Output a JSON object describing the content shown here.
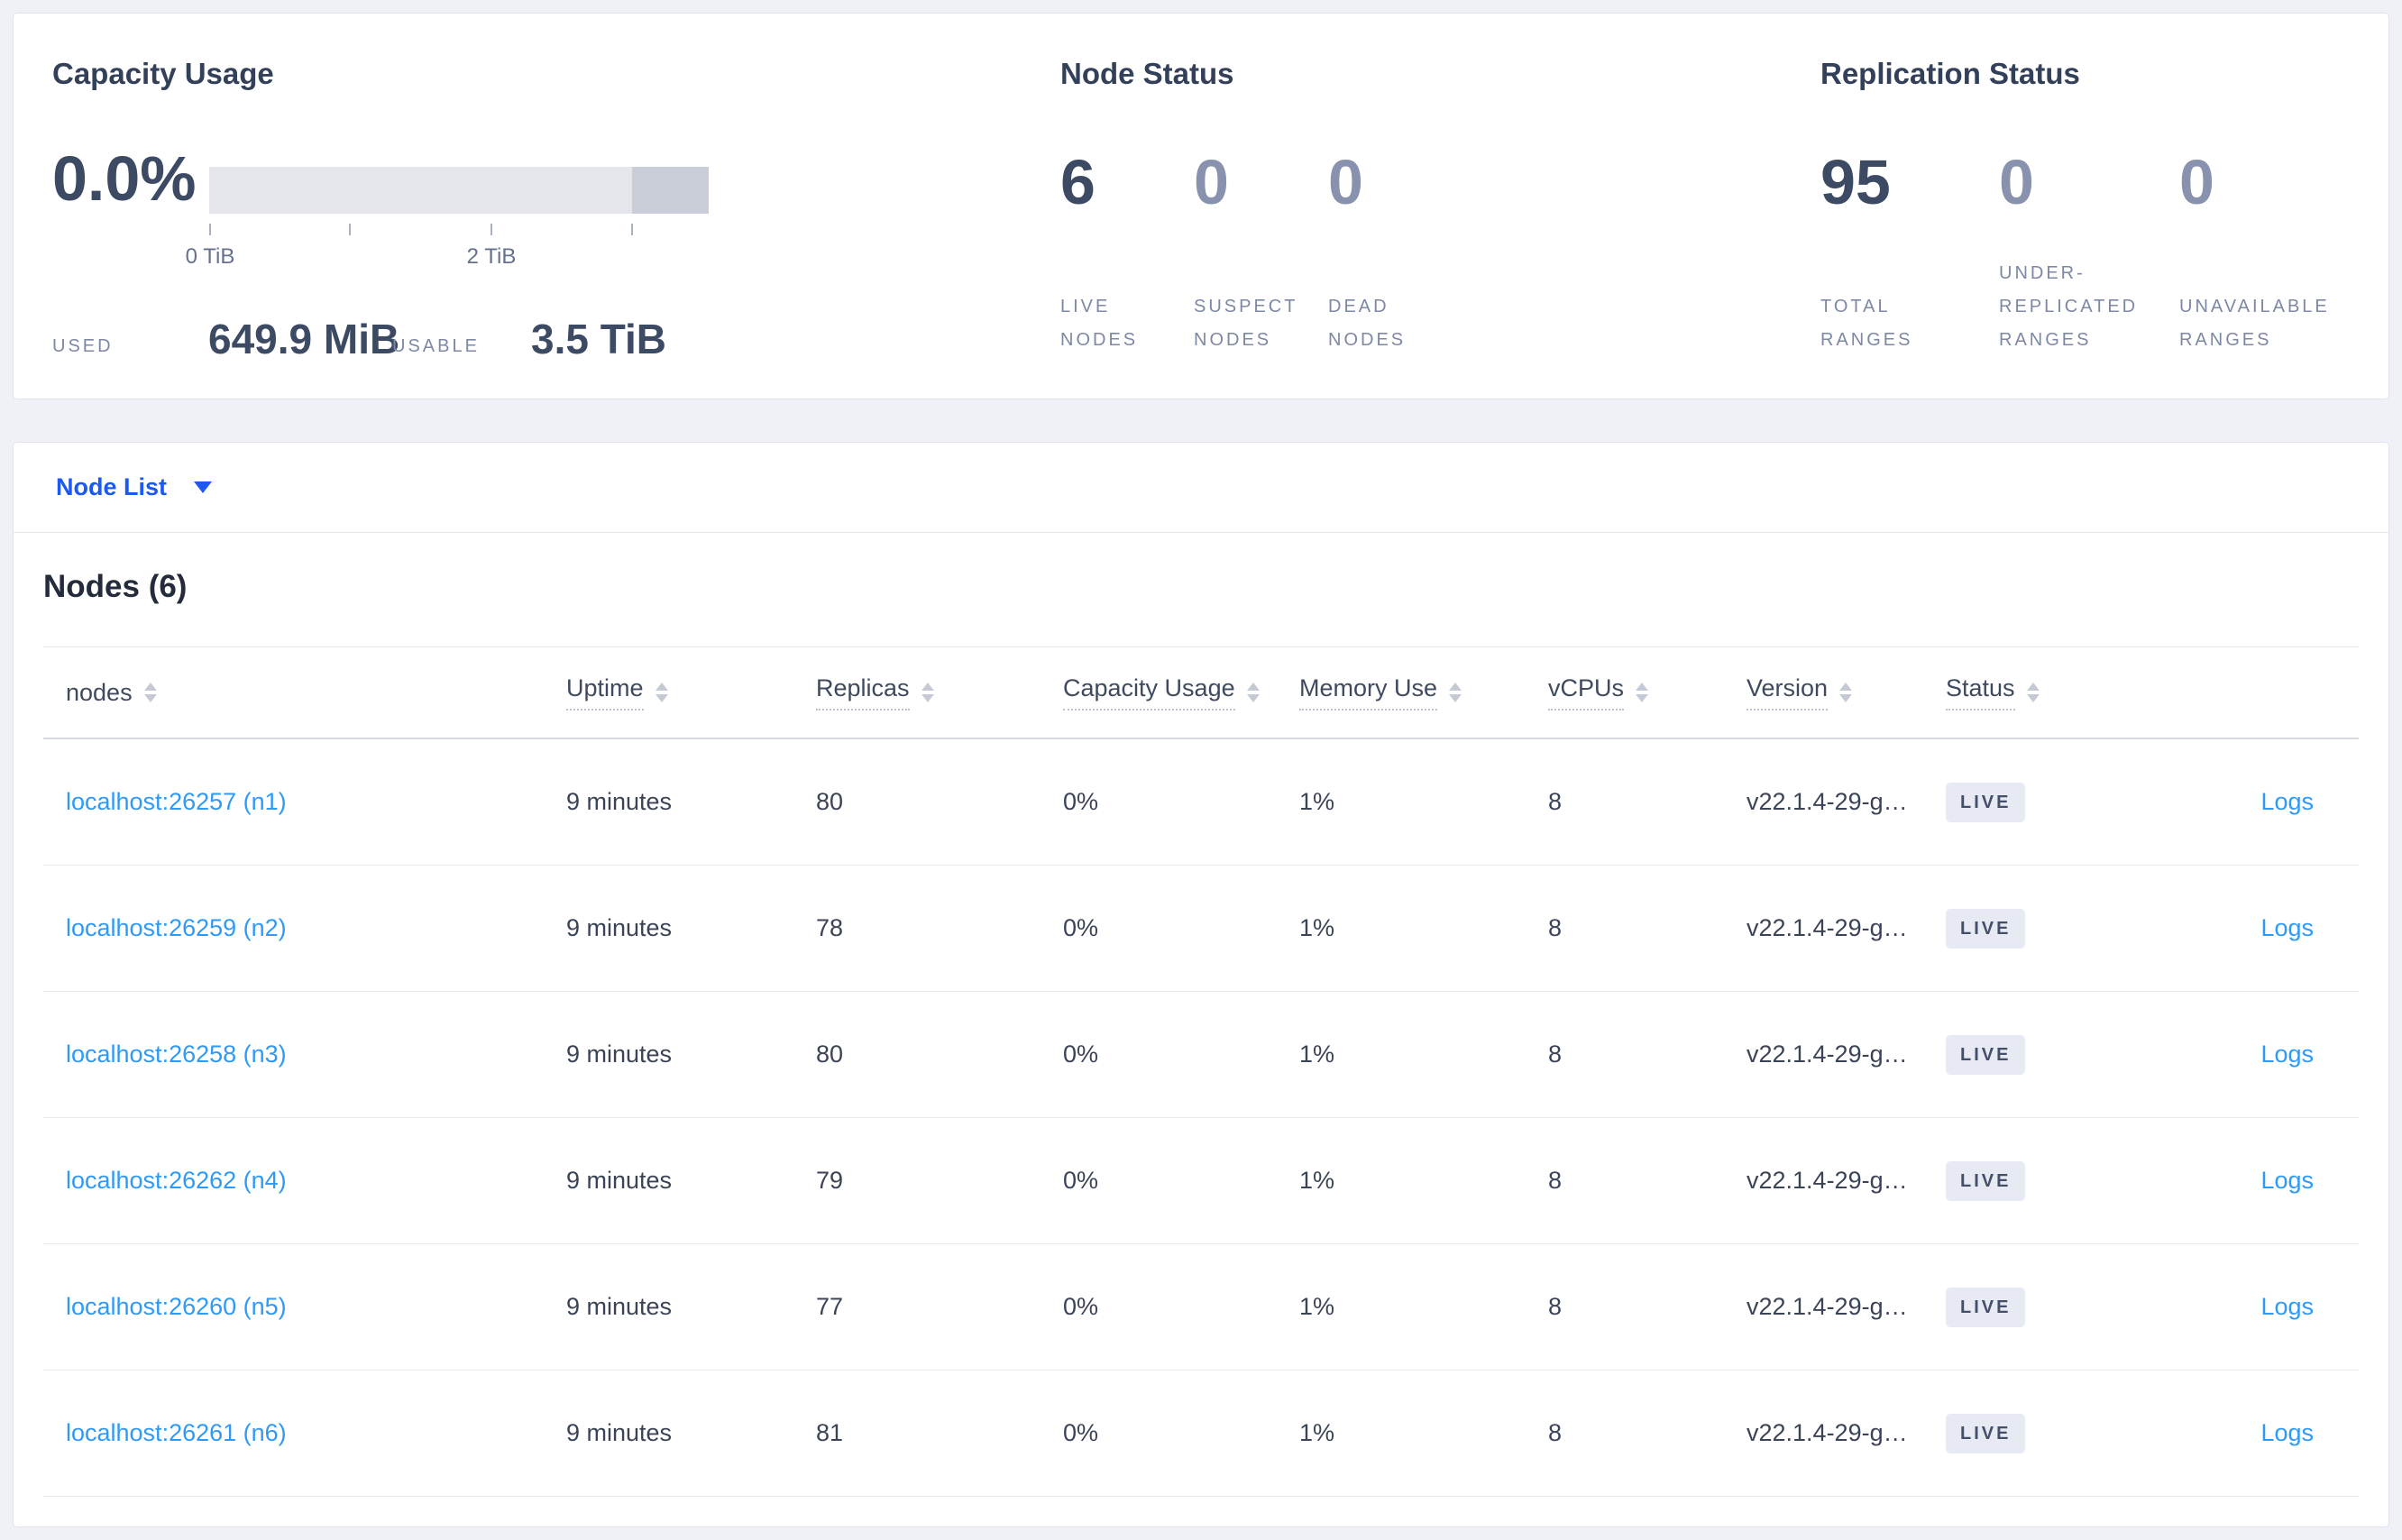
{
  "summary": {
    "capacity": {
      "title": "Capacity Usage",
      "percent": "0.0%",
      "axis": {
        "tick_start_label": "0 TiB",
        "tick_mid_label": "2 TiB"
      },
      "used_label": "USED",
      "used_value": "649.9 MiB",
      "usable_label": "USABLE",
      "usable_value": "3.5 TiB"
    },
    "node_status": {
      "title": "Node Status",
      "stats": [
        {
          "value": "6",
          "lines": [
            "LIVE",
            "NODES"
          ],
          "muted": false
        },
        {
          "value": "0",
          "lines": [
            "SUSPECT",
            "NODES"
          ],
          "muted": true
        },
        {
          "value": "0",
          "lines": [
            "DEAD",
            "NODES"
          ],
          "muted": true
        }
      ]
    },
    "replication_status": {
      "title": "Replication Status",
      "stats": [
        {
          "value": "95",
          "lines": [
            "TOTAL",
            "RANGES"
          ],
          "muted": false
        },
        {
          "value": "0",
          "lines": [
            "UNDER-",
            "REPLICATED",
            "RANGES"
          ],
          "muted": true
        },
        {
          "value": "0",
          "lines": [
            "UNAVAILABLE",
            "RANGES"
          ],
          "muted": true
        }
      ]
    }
  },
  "node_list_dropdown": {
    "label": "Node List",
    "icon": "caret-down"
  },
  "nodes_table": {
    "heading": "Nodes (6)",
    "columns": [
      {
        "label": "nodes",
        "underlined": false
      },
      {
        "label": "Uptime",
        "underlined": true
      },
      {
        "label": "Replicas",
        "underlined": true
      },
      {
        "label": "Capacity Usage",
        "underlined": true
      },
      {
        "label": "Memory Use",
        "underlined": true
      },
      {
        "label": "vCPUs",
        "underlined": true
      },
      {
        "label": "Version",
        "underlined": true
      },
      {
        "label": "Status",
        "underlined": true
      }
    ],
    "rows": [
      {
        "node": "localhost:26257 (n1)",
        "uptime": "9 minutes",
        "replicas": "80",
        "capacity": "0%",
        "memory": "1%",
        "vcpus": "8",
        "version": "v22.1.4-29-g…",
        "status": "LIVE",
        "logs": "Logs"
      },
      {
        "node": "localhost:26259 (n2)",
        "uptime": "9 minutes",
        "replicas": "78",
        "capacity": "0%",
        "memory": "1%",
        "vcpus": "8",
        "version": "v22.1.4-29-g…",
        "status": "LIVE",
        "logs": "Logs"
      },
      {
        "node": "localhost:26258 (n3)",
        "uptime": "9 minutes",
        "replicas": "80",
        "capacity": "0%",
        "memory": "1%",
        "vcpus": "8",
        "version": "v22.1.4-29-g…",
        "status": "LIVE",
        "logs": "Logs"
      },
      {
        "node": "localhost:26262 (n4)",
        "uptime": "9 minutes",
        "replicas": "79",
        "capacity": "0%",
        "memory": "1%",
        "vcpus": "8",
        "version": "v22.1.4-29-g…",
        "status": "LIVE",
        "logs": "Logs"
      },
      {
        "node": "localhost:26260 (n5)",
        "uptime": "9 minutes",
        "replicas": "77",
        "capacity": "0%",
        "memory": "1%",
        "vcpus": "8",
        "version": "v22.1.4-29-g…",
        "status": "LIVE",
        "logs": "Logs"
      },
      {
        "node": "localhost:26261 (n6)",
        "uptime": "9 minutes",
        "replicas": "81",
        "capacity": "0%",
        "memory": "1%",
        "vcpus": "8",
        "version": "v22.1.4-29-g…",
        "status": "LIVE",
        "logs": "Logs"
      }
    ]
  },
  "colors": {
    "page_background": "#eff1f6",
    "accent_blue": "#1c58f2",
    "link_blue": "#2f9af5",
    "dark_value": "#3d4a63",
    "muted_value": "#8892ae",
    "label_slate": "#7d88a5",
    "bar_track": "#e4e6ec",
    "bar_segment": "#c9cdd7",
    "badge_background": "#e7eaf2"
  }
}
